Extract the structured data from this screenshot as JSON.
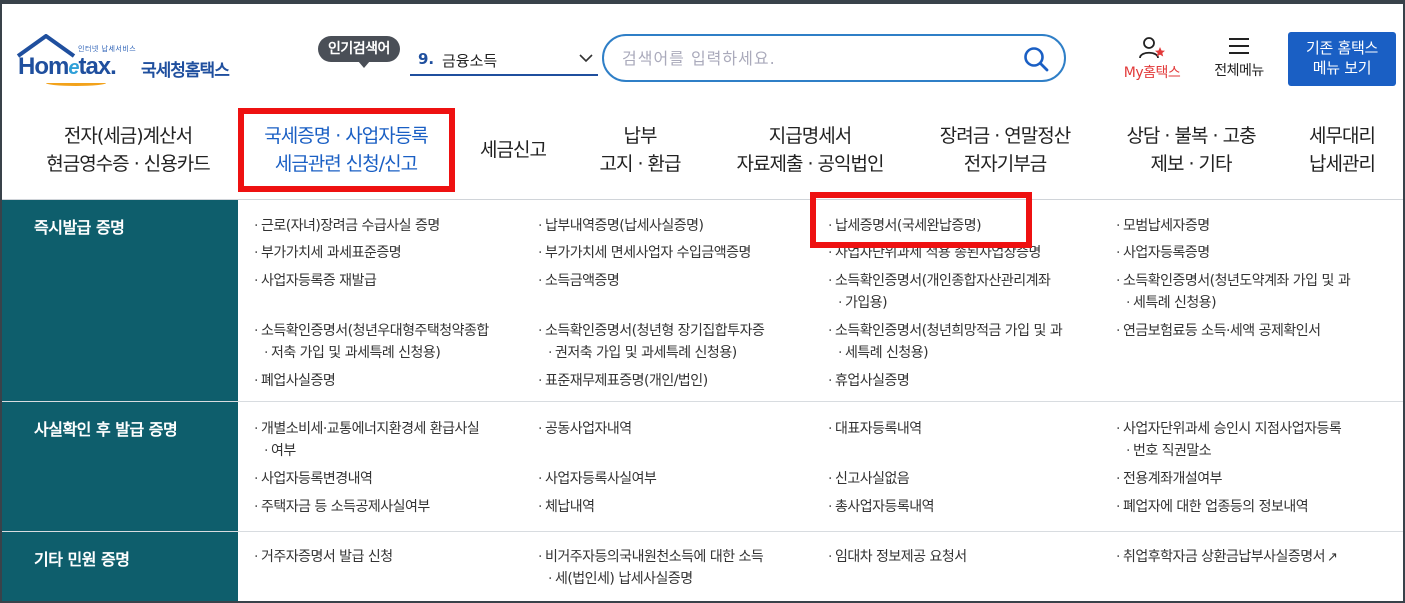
{
  "header": {
    "logo": {
      "small_text": "인터넷 납세서비스",
      "word_pre": "Hom",
      "word_e": "e",
      "word_post": "tax.",
      "korean": "국세청홈택스"
    },
    "popular": {
      "badge": "인기검색어",
      "rank": "9.",
      "term": "금융소득"
    },
    "search": {
      "placeholder": "검색어를 입력하세요."
    },
    "my_hometax": "My홈택스",
    "all_menu": "전체메뉴",
    "legacy_button": {
      "line1": "기존 홈택스",
      "line2": "메뉴 보기"
    }
  },
  "nav": [
    {
      "line1": "전자(세금)계산서",
      "line2": "현금영수증 · 신용카드"
    },
    {
      "line1": "국세증명 · 사업자등록",
      "line2": "세금관련 신청/신고"
    },
    {
      "line1": "세금신고",
      "line2": ""
    },
    {
      "line1": "납부",
      "line2": "고지 · 환급"
    },
    {
      "line1": "지급명세서",
      "line2": "자료제출 · 공익법인"
    },
    {
      "line1": "장려금 · 연말정산",
      "line2": "전자기부금"
    },
    {
      "line1": "상담 · 불복 · 고충",
      "line2": "제보 · 기타"
    },
    {
      "line1": "세무대리",
      "line2": "납세관리"
    }
  ],
  "sections": [
    {
      "title": "즉시발급 증명",
      "items": [
        "근로(자녀)장려금 수급사실 증명",
        "납부내역증명(납세사실증명)",
        "납세증명서(국세완납증명)",
        "모범납세자증명",
        "부가가치세 과세표준증명",
        "부가가치세 면세사업자 수입금액증명",
        "사업자단위과세 적용 종된사업장증명",
        "사업자등록증명",
        "사업자등록증 재발급",
        "소득금액증명",
        "소득확인증명서(개인종합자산관리계좌",
        "가입용)",
        "소득확인증명서(청년도약계좌 가입 및 과",
        "세특례 신청용)",
        "소득확인증명서(청년우대형주택청약종합",
        "저축 가입 및 과세특례 신청용)",
        "소득확인증명서(청년형 장기집합투자증",
        "권저축 가입 및 과세특례 신청용)",
        "소득확인증명서(청년희망적금 가입 및 과",
        "세특례 신청용)",
        "연금보험료등 소득·세액 공제확인서",
        "폐업사실증명",
        "표준재무제표증명(개인/법인)",
        "휴업사실증명"
      ]
    },
    {
      "title": "사실확인 후 발급 증명",
      "items": [
        "개별소비세·교통에너지환경세 환급사실",
        "여부",
        "공동사업자내역",
        "대표자등록내역",
        "사업자단위과세 승인시 지점사업자등록",
        "번호 직권말소",
        "사업자등록변경내역",
        "사업자등록사실여부",
        "신고사실없음",
        "전용계좌개설여부",
        "주택자금 등 소득공제사실여부",
        "체납내역",
        "총사업자등록내역",
        "폐업자에 대한 업종등의 정보내역"
      ]
    },
    {
      "title": "기타 민원 증명",
      "items": [
        "거주자증명서 발급 신청",
        "비거주자등의국내원천소득에 대한 소득",
        "세(법인세) 납세사실증명",
        "임대차 정보제공 요청서",
        "취업후학자금 상환금납부사실증명서"
      ]
    }
  ],
  "colors": {
    "accent": "#1a5fc4",
    "section_bg": "#0e5e6c",
    "highlight": "#ee1111",
    "my_red": "#e23a3a"
  },
  "icons": [
    "house-logo-icon",
    "chevron-down-icon",
    "search-icon",
    "user-star-icon",
    "hamburger-icon",
    "external-link-icon"
  ]
}
